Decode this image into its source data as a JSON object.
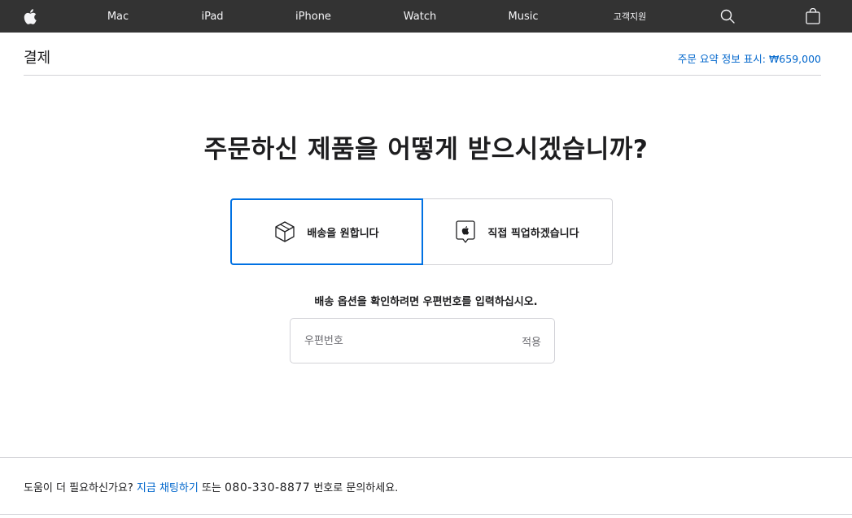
{
  "nav": {
    "items": [
      {
        "label": "Mac"
      },
      {
        "label": "iPad"
      },
      {
        "label": "iPhone"
      },
      {
        "label": "Watch"
      },
      {
        "label": "Music"
      },
      {
        "label": "고객지원"
      }
    ],
    "icons": {
      "logo": "apple-logo-icon",
      "search": "search-icon",
      "bag": "shopping-bag-icon"
    }
  },
  "checkout": {
    "title": "결제",
    "summary_link": "주문 요약 정보 표시: ₩659,000"
  },
  "question": "주문하신 제품을 어떻게 받으시겠습니까?",
  "options": [
    {
      "label": "배송을 원합니다",
      "icon": "box-icon",
      "selected": true
    },
    {
      "label": "직접 픽업하겠습니다",
      "icon": "apple-store-icon",
      "selected": false
    }
  ],
  "zip": {
    "prompt": "배송 옵션을 확인하려면 우편번호를 입력하십시오.",
    "placeholder": "우편번호",
    "value": "",
    "apply_label": "적용"
  },
  "footer": {
    "help_prefix": "도움이 더 필요하신가요?",
    "chat_link": "지금 채팅하기",
    "middle": "또는",
    "phone": "080-330-8877",
    "suffix": "번호로 문의하세요."
  },
  "colors": {
    "nav_bg": "#333333",
    "link": "#0066cc",
    "selected_border": "#0071e3",
    "text": "#1d1d1f"
  }
}
